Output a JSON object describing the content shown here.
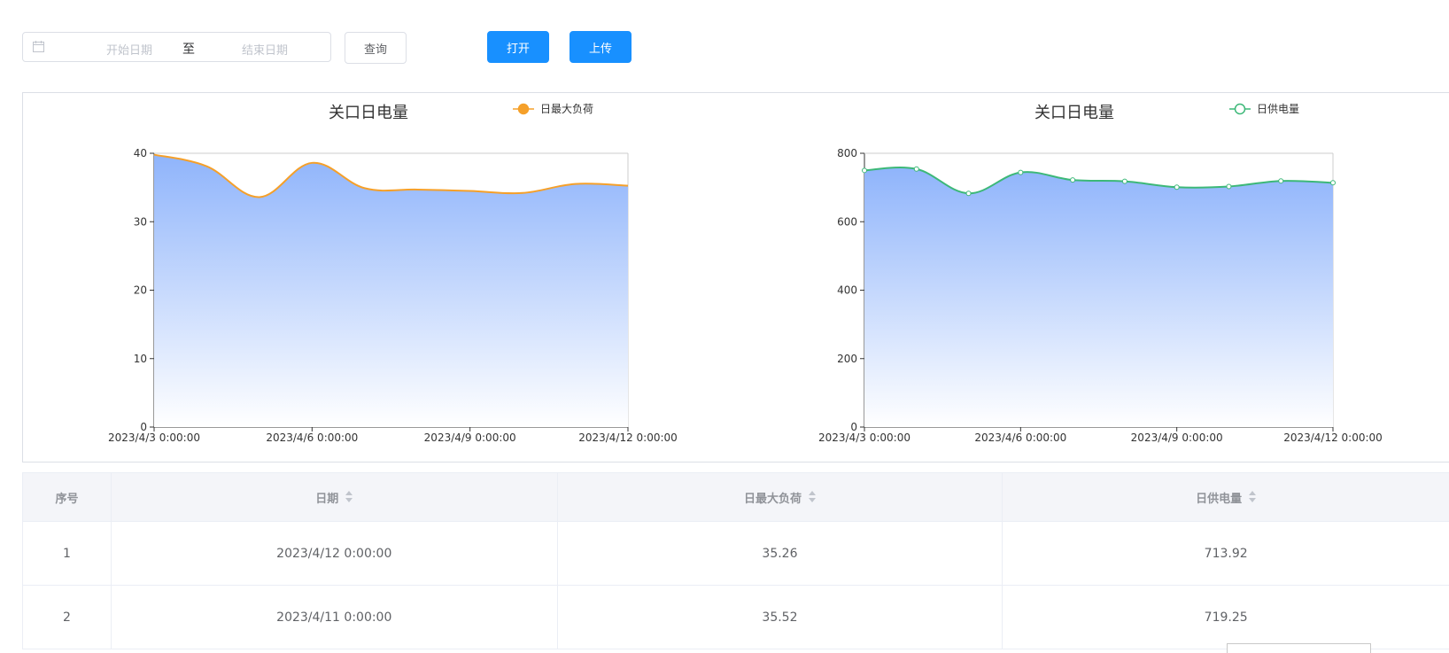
{
  "toolbar": {
    "start_placeholder": "开始日期",
    "separator": "至",
    "end_placeholder": "结束日期",
    "query_label": "查询",
    "open_label": "打开",
    "upload_label": "上传"
  },
  "colors": {
    "primary": "#1890ff",
    "orange": "#f5a02a",
    "green": "#3cb878",
    "area_top": "#8fb4fb"
  },
  "chart_data": [
    {
      "type": "area",
      "title": "关口日电量",
      "legend": "日最大负荷",
      "series_color": "#f5a02a",
      "x": [
        "2023/4/3 0:00:00",
        "2023/4/4 0:00:00",
        "2023/4/5 0:00:00",
        "2023/4/6 0:00:00",
        "2023/4/7 0:00:00",
        "2023/4/8 0:00:00",
        "2023/4/9 0:00:00",
        "2023/4/10 0:00:00",
        "2023/4/11 0:00:00",
        "2023/4/12 0:00:00"
      ],
      "values": [
        39.8,
        38.1,
        33.6,
        38.6,
        34.9,
        34.7,
        34.5,
        34.2,
        35.52,
        35.26
      ],
      "x_tick_labels": [
        "2023/4/3 0:00:00",
        "2023/4/6 0:00:00",
        "2023/4/9 0:00:00",
        "2023/4/12 0:00:00"
      ],
      "y_ticks": [
        "0",
        "10",
        "20",
        "30",
        "40"
      ],
      "ylim": [
        0,
        40
      ]
    },
    {
      "type": "area",
      "title": "关口日电量",
      "legend": "日供电量",
      "series_color": "#3cb878",
      "x": [
        "2023/4/3 0:00:00",
        "2023/4/4 0:00:00",
        "2023/4/5 0:00:00",
        "2023/4/6 0:00:00",
        "2023/4/7 0:00:00",
        "2023/4/8 0:00:00",
        "2023/4/9 0:00:00",
        "2023/4/10 0:00:00",
        "2023/4/11 0:00:00",
        "2023/4/12 0:00:00"
      ],
      "values": [
        750,
        754,
        683,
        744,
        722,
        718,
        701,
        703,
        719.25,
        713.92
      ],
      "x_tick_labels": [
        "2023/4/3 0:00:00",
        "2023/4/6 0:00:00",
        "2023/4/9 0:00:00",
        "2023/4/12 0:00:00"
      ],
      "y_ticks": [
        "0",
        "200",
        "400",
        "600",
        "800"
      ],
      "ylim": [
        0,
        800
      ]
    }
  ],
  "table": {
    "headers": [
      "序号",
      "日期",
      "日最大负荷",
      "日供电量"
    ],
    "rows": [
      [
        "1",
        "2023/4/12 0:00:00",
        "35.26",
        "713.92"
      ],
      [
        "2",
        "2023/4/11 0:00:00",
        "35.52",
        "719.25"
      ]
    ]
  }
}
